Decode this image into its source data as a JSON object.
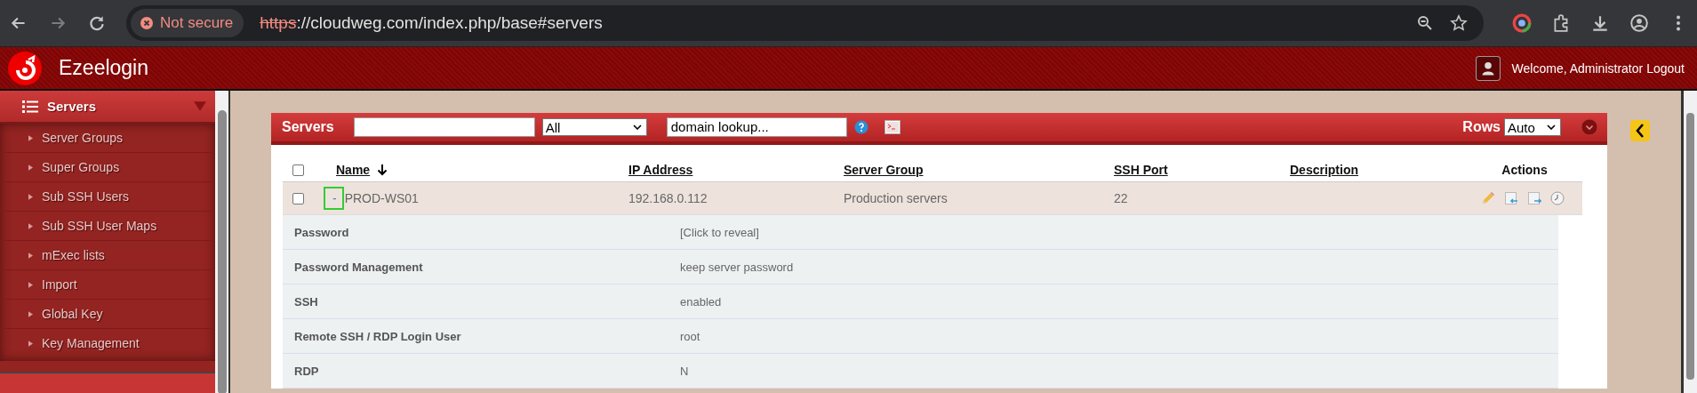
{
  "browser": {
    "security": "Not secure",
    "url_scheme": "https",
    "url_rest": "://cloudweg.com/index.php/base#servers"
  },
  "header": {
    "app_name": "Ezeelogin",
    "welcome": "Welcome, Administrator",
    "logout": "Logout"
  },
  "sidebar": {
    "section": {
      "label": "Servers",
      "expanded": true
    },
    "items": [
      {
        "label": "Server Groups"
      },
      {
        "label": "Super Groups"
      },
      {
        "label": "Sub SSH Users"
      },
      {
        "label": "Sub SSH User Maps"
      },
      {
        "label": "mExec lists"
      },
      {
        "label": "Import"
      },
      {
        "label": "Global Key"
      },
      {
        "label": "Key Management"
      }
    ]
  },
  "panel": {
    "title": "Servers",
    "filter": "All",
    "lookup": "domain lookup...",
    "rows_label": "Rows",
    "rows_value": "Auto"
  },
  "table": {
    "columns": [
      {
        "label": "Name",
        "sortable": true,
        "sorted": true
      },
      {
        "label": "IP Address",
        "sortable": true,
        "sorted": false
      },
      {
        "label": "Server Group",
        "sortable": true,
        "sorted": false
      },
      {
        "label": "SSH Port",
        "sortable": true,
        "sorted": false
      },
      {
        "label": "Description",
        "sortable": true,
        "sorted": false
      },
      {
        "label": "Actions",
        "sortable": false,
        "sorted": false
      }
    ],
    "select_all_checked": false,
    "rows": [
      {
        "checked": false,
        "expanded": true,
        "toggle": "-",
        "name": "PROD-WS01",
        "ip": "192.168.0.112",
        "group": "Production servers",
        "port": "22"
      }
    ],
    "details": [
      {
        "label": "Password",
        "value": "[Click to reveal]"
      },
      {
        "label": "Password Management",
        "value": "keep server password"
      },
      {
        "label": "SSH",
        "value": "enabled"
      },
      {
        "label": "Remote SSH / RDP Login User",
        "value": "root"
      },
      {
        "label": "RDP",
        "value": "N"
      }
    ]
  }
}
